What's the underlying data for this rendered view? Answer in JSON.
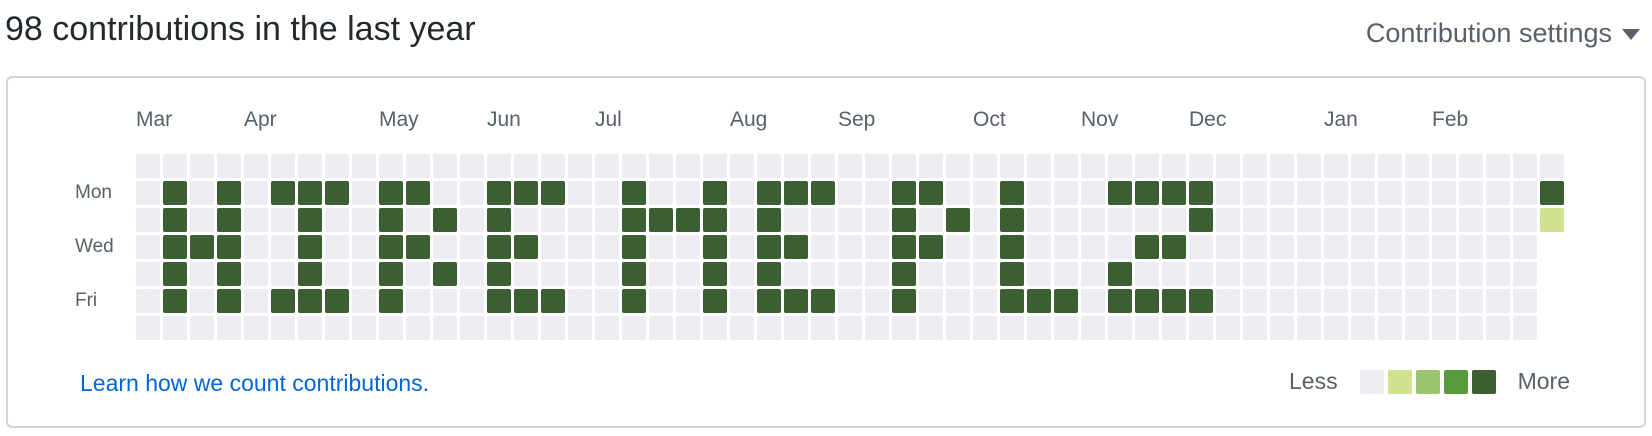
{
  "header": {
    "title": "98 contributions in the last year",
    "settings_label": "Contribution settings"
  },
  "calendar": {
    "months": [
      {
        "label": "Mar",
        "week": 0
      },
      {
        "label": "Apr",
        "week": 4
      },
      {
        "label": "May",
        "week": 9
      },
      {
        "label": "Jun",
        "week": 13
      },
      {
        "label": "Jul",
        "week": 17
      },
      {
        "label": "Aug",
        "week": 22
      },
      {
        "label": "Sep",
        "week": 26
      },
      {
        "label": "Oct",
        "week": 31
      },
      {
        "label": "Nov",
        "week": 35
      },
      {
        "label": "Dec",
        "week": 39
      },
      {
        "label": "Jan",
        "week": 44
      },
      {
        "label": "Feb",
        "week": 48
      }
    ],
    "day_labels": [
      {
        "label": "Mon",
        "row": 1
      },
      {
        "label": "Wed",
        "row": 3
      },
      {
        "label": "Fri",
        "row": 5
      }
    ],
    "week_count": 53,
    "last_week_days": 3,
    "level_colors": [
      "#ebedf0",
      "#d0e28f",
      "#9ac46d",
      "#5a9a3e",
      "#3b5f30"
    ],
    "active_cells": [
      {
        "week": 1,
        "days": [
          1,
          2,
          3,
          4,
          5
        ]
      },
      {
        "week": 2,
        "days": [
          3
        ]
      },
      {
        "week": 3,
        "days": [
          1,
          2,
          3,
          4,
          5
        ]
      },
      {
        "week": 5,
        "days": [
          1,
          5
        ]
      },
      {
        "week": 6,
        "days": [
          1,
          2,
          3,
          4,
          5
        ]
      },
      {
        "week": 7,
        "days": [
          1,
          5
        ]
      },
      {
        "week": 9,
        "days": [
          1,
          2,
          3,
          4,
          5
        ]
      },
      {
        "week": 10,
        "days": [
          1,
          3
        ]
      },
      {
        "week": 11,
        "days": [
          2,
          4
        ]
      },
      {
        "week": 13,
        "days": [
          1,
          2,
          3,
          4,
          5
        ]
      },
      {
        "week": 14,
        "days": [
          1,
          3,
          5
        ]
      },
      {
        "week": 15,
        "days": [
          1,
          5
        ]
      },
      {
        "week": 18,
        "days": [
          1,
          2,
          3,
          4,
          5
        ]
      },
      {
        "week": 19,
        "days": [
          2
        ]
      },
      {
        "week": 20,
        "days": [
          2
        ]
      },
      {
        "week": 21,
        "days": [
          1,
          2,
          3,
          4,
          5
        ]
      },
      {
        "week": 23,
        "days": [
          1,
          2,
          3,
          4,
          5
        ]
      },
      {
        "week": 24,
        "days": [
          1,
          3,
          5
        ]
      },
      {
        "week": 25,
        "days": [
          1,
          5
        ]
      },
      {
        "week": 28,
        "days": [
          1,
          2,
          3,
          4,
          5
        ]
      },
      {
        "week": 29,
        "days": [
          1,
          3
        ]
      },
      {
        "week": 30,
        "days": [
          2
        ]
      },
      {
        "week": 32,
        "days": [
          1,
          2,
          3,
          4,
          5
        ]
      },
      {
        "week": 33,
        "days": [
          5
        ]
      },
      {
        "week": 34,
        "days": [
          5
        ]
      },
      {
        "week": 36,
        "days": [
          1,
          4,
          5
        ]
      },
      {
        "week": 37,
        "days": [
          1,
          3,
          5
        ]
      },
      {
        "week": 38,
        "days": [
          1,
          3,
          5
        ]
      },
      {
        "week": 39,
        "days": [
          1,
          2,
          5
        ]
      },
      {
        "week": 52,
        "days": [
          1
        ],
        "level": 4
      },
      {
        "week": 52,
        "days": [
          2
        ],
        "level": 1
      }
    ]
  },
  "footer": {
    "learn_link": "Learn how we count contributions.",
    "legend_less": "Less",
    "legend_more": "More"
  }
}
